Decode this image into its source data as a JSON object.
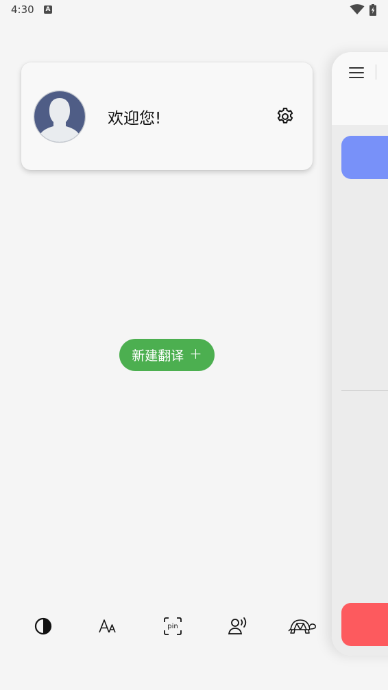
{
  "status_bar": {
    "time": "4:30",
    "notification_icon_label": "A",
    "icons": [
      "wifi-icon",
      "battery-charging-icon"
    ]
  },
  "profile": {
    "avatar_icon": "default-user-avatar-icon",
    "welcome": "欢迎您!",
    "settings_icon": "gear-icon"
  },
  "main": {
    "new_translation_label": "新建翻译",
    "new_translation_icon": "+"
  },
  "toolbar": {
    "items": [
      {
        "name": "theme-contrast-icon"
      },
      {
        "name": "font-size-icon"
      },
      {
        "name": "pinyin-icon",
        "label": "pin"
      },
      {
        "name": "voice-speak-icon"
      },
      {
        "name": "turtle-slow-icon"
      }
    ]
  },
  "side_panel": {
    "menu_icon": "hamburger-menu-icon",
    "colors": {
      "primary_button": "#7891f9",
      "danger_button": "#fd5a5e"
    }
  },
  "colors": {
    "accent_green": "#4caf50",
    "background": "#f5f5f5"
  }
}
